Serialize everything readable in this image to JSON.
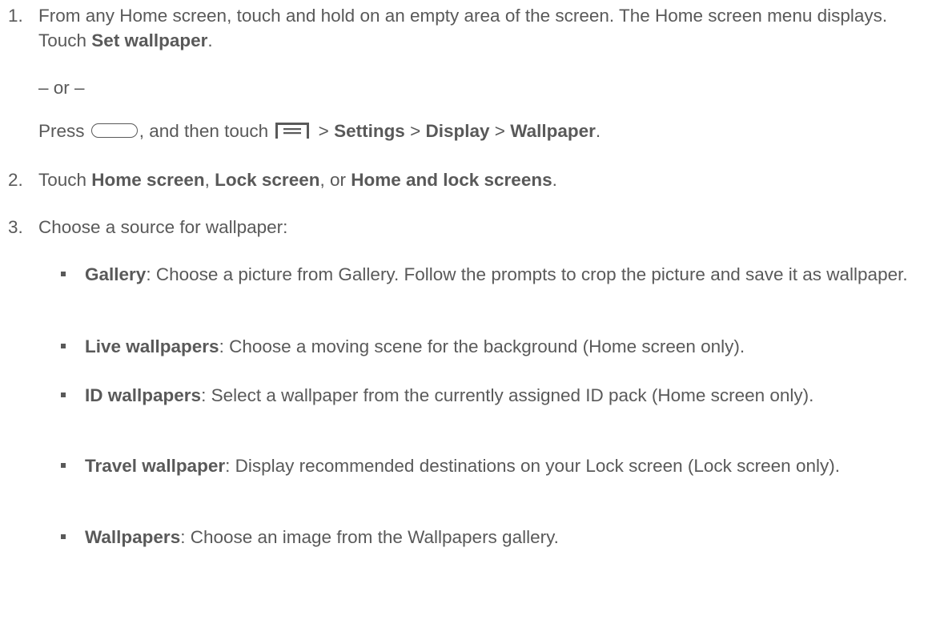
{
  "steps": [
    {
      "number": "1.",
      "part1": "From any Home screen, touch and hold on an empty area of the screen. The Home screen menu displays. Touch ",
      "bold1": "Set wallpaper",
      "part2": "."
    },
    {
      "number": "2.",
      "part1": "Touch ",
      "bold1": "Home screen",
      "part2": ", ",
      "bold2": "Lock screen",
      "part3": ", or ",
      "bold3": "Home and lock screens",
      "part4": "."
    },
    {
      "number": "3.",
      "part1": "Choose a source for wallpaper:"
    }
  ],
  "or_text": "– or –",
  "press_line": {
    "press": "Press ",
    "and_then": ", and then touch ",
    "sep": " > ",
    "settings": "Settings",
    "display": "Display",
    "wallpaper": "Wallpaper",
    "end": ".",
    "home_key_icon": "home-key-icon",
    "menu_key_icon": "menu-key-icon"
  },
  "sources": [
    {
      "label": "Gallery",
      "desc": ": Choose a picture from Gallery. Follow the prompts to crop the picture and save it as wallpaper."
    },
    {
      "label": "Live wallpapers",
      "desc": ": Choose a moving scene for the background (Home screen only)."
    },
    {
      "label": "ID wallpapers",
      "desc": ": Select a wallpaper from the currently assigned ID pack (Home screen only)."
    },
    {
      "label": "Travel wallpaper",
      "desc": ": Display recommended destinations on your Lock screen (Lock screen only)."
    },
    {
      "label": "Wallpapers",
      "desc": ": Choose an image from the Wallpapers gallery."
    }
  ],
  "colors": {
    "text": "#595959",
    "background": "#ffffff"
  }
}
